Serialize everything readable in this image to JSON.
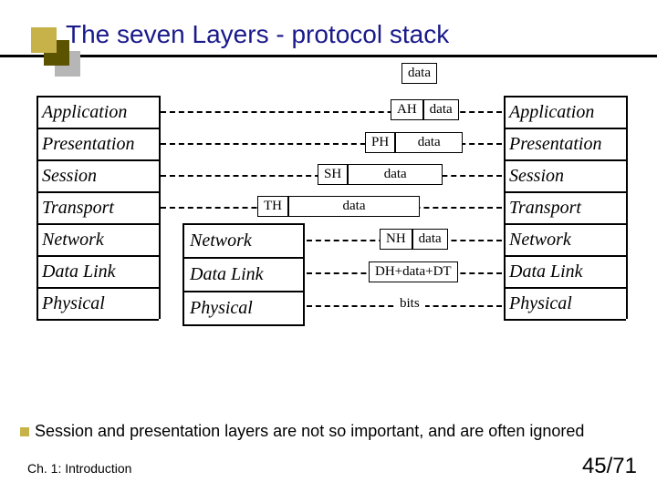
{
  "title": "The seven Layers - protocol stack",
  "layers_left": [
    "Application",
    "Presentation",
    "Session",
    "Transport",
    "Network",
    "Data Link",
    "Physical"
  ],
  "layers_right": [
    "Application",
    "Presentation",
    "Session",
    "Transport",
    "Network",
    "Data Link",
    "Physical"
  ],
  "mid_stack": [
    "Network",
    "Data Link",
    "Physical"
  ],
  "packets": {
    "top": {
      "cells": [
        "data"
      ]
    },
    "app": {
      "cells": [
        "AH",
        "data"
      ]
    },
    "pres": {
      "cells": [
        "PH",
        "data"
      ]
    },
    "sess": {
      "cells": [
        "SH",
        "data"
      ]
    },
    "trans": {
      "cells": [
        "TH",
        "data"
      ]
    },
    "net": {
      "cells": [
        "NH",
        "data"
      ]
    },
    "dlink": {
      "cells": [
        "DH+data+DT"
      ]
    },
    "phys": {
      "cells": [
        "bits"
      ]
    }
  },
  "bullet": "Session and presentation layers are not so important, and are often ignored",
  "chapter": "Ch. 1: Introduction",
  "page": "45/71"
}
